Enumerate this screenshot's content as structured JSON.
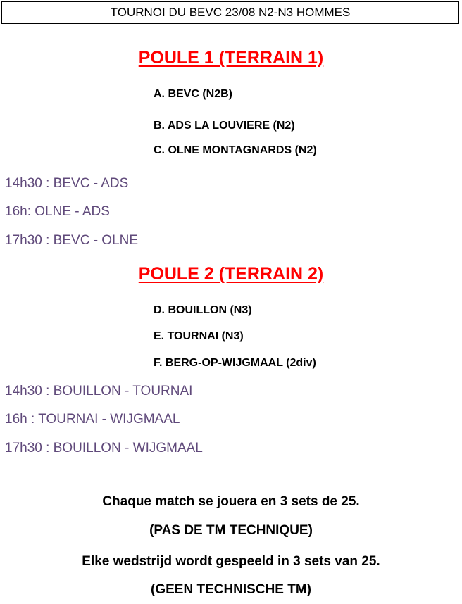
{
  "header": {
    "title": "TOURNOI DU BEVC 23/08 N2-N3 HOMMES"
  },
  "pool1": {
    "title": "POULE 1 (TERRAIN 1)",
    "teams": [
      "A. BEVC (N2B)",
      "B. ADS LA LOUVIERE (N2)",
      "C. OLNE MONTAGNARDS (N2)"
    ],
    "matches": [
      "14h30 : BEVC - ADS",
      "16h: OLNE - ADS",
      "17h30 : BEVC - OLNE"
    ]
  },
  "pool2": {
    "title": "POULE 2 (TERRAIN 2)",
    "teams": [
      "D. BOUILLON (N3)",
      "E. TOURNAI (N3)",
      "F. BERG-OP-WIJGMAAL (2div)"
    ],
    "matches": [
      "14h30 : BOUILLON - TOURNAI",
      "16h : TOURNAI - WIJGMAAL",
      "17h30 : BOUILLON - WIJGMAAL"
    ]
  },
  "notes": {
    "line1": "Chaque match se jouera en 3 sets de 25.",
    "line2": "(PAS DE TM TECHNIQUE)",
    "line3": "Elke wedstrijd wordt gespeeld in 3 sets van 25.",
    "line4": "(GEEN TECHNISCHE TM)"
  },
  "colors": {
    "pool_title": "#ff0000",
    "match_text": "#604a7b",
    "text": "#000000"
  }
}
